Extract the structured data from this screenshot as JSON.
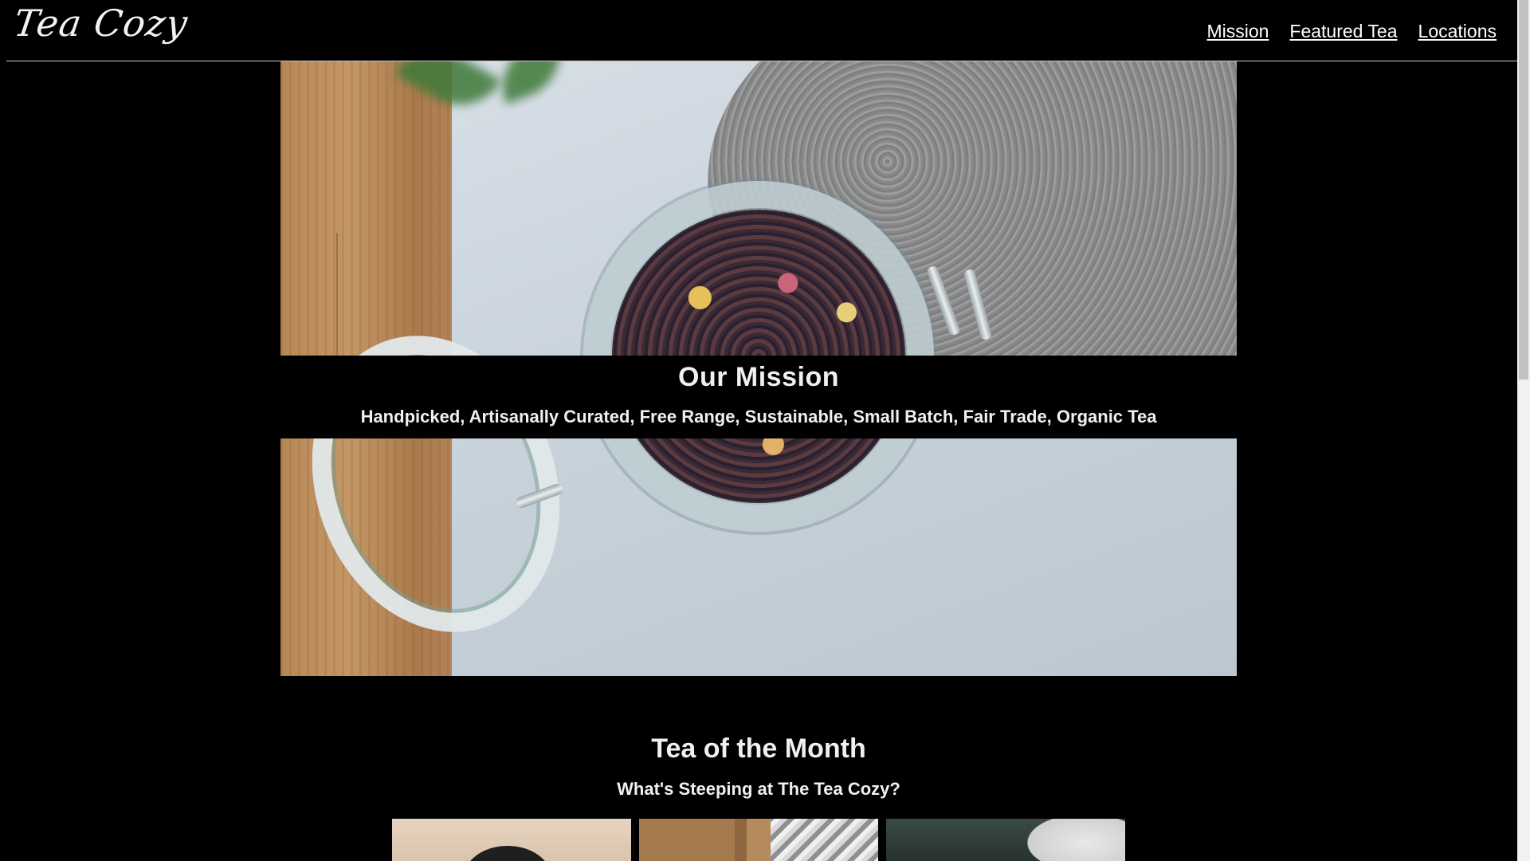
{
  "header": {
    "logo": "Tea Cozy",
    "nav": [
      {
        "label": "Mission"
      },
      {
        "label": "Featured Tea"
      },
      {
        "label": "Locations"
      }
    ]
  },
  "mission": {
    "title": "Our Mission",
    "subtitle": "Handpicked, Artisanally Curated, Free Range, Sustainable, Small Batch, Fair Trade, Organic Tea"
  },
  "tea_of_month": {
    "title": "Tea of the Month",
    "subtitle": "What's Steeping at The Tea Cozy?"
  }
}
